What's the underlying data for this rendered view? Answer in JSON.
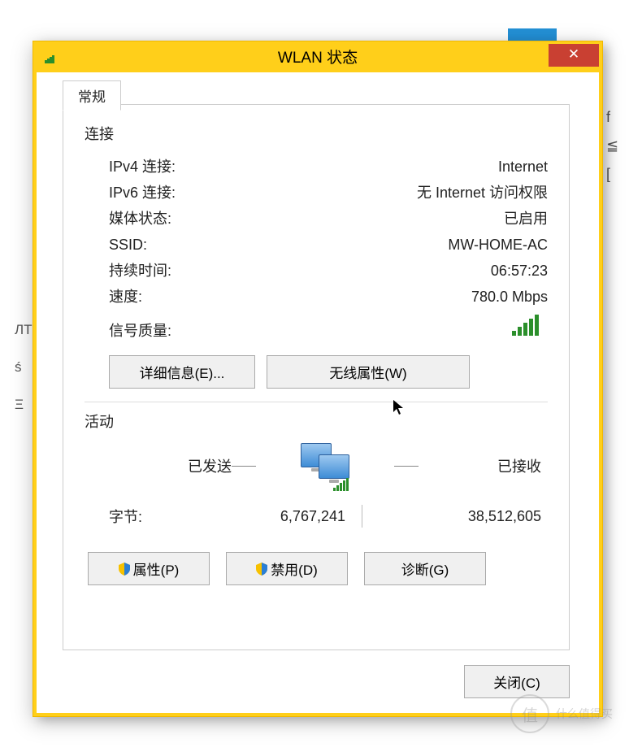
{
  "window": {
    "title": "WLAN 状态",
    "close_glyph": "✕"
  },
  "tabs": {
    "general": "常规"
  },
  "connection": {
    "section": "连接",
    "ipv4_label": "IPv4 连接:",
    "ipv4_value": "Internet",
    "ipv6_label": "IPv6 连接:",
    "ipv6_value": "无 Internet 访问权限",
    "media_label": "媒体状态:",
    "media_value": "已启用",
    "ssid_label": "SSID:",
    "ssid_value": "MW-HOME-AC",
    "duration_label": "持续时间:",
    "duration_value": "06:57:23",
    "speed_label": "速度:",
    "speed_value": "780.0 Mbps",
    "signal_label": "信号质量:"
  },
  "buttons": {
    "details": "详细信息(E)...",
    "wireless_props": "无线属性(W)",
    "properties": "属性(P)",
    "disable": "禁用(D)",
    "diagnose": "诊断(G)",
    "close": "关闭(C)"
  },
  "activity": {
    "section": "活动",
    "sent_label": "已发送",
    "recv_label": "已接收",
    "bytes_label": "字节:",
    "bytes_sent": "6,767,241",
    "bytes_recv": "38,512,605"
  },
  "watermark": {
    "glyph": "值",
    "text": "什么值得买"
  }
}
